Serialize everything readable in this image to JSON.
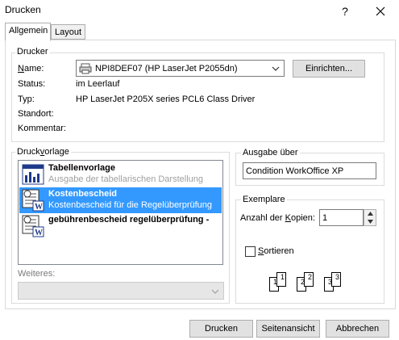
{
  "window": {
    "title": "Drucken",
    "help_label": "?",
    "close_label": "✕"
  },
  "tabs": [
    {
      "label": "Allgemein"
    },
    {
      "label": "Layout"
    }
  ],
  "printer": {
    "group_label": "Drucker",
    "name_label": "Name:",
    "name_value": "NPI8DEF07 (HP LaserJet P2055dn)",
    "setup_button": "Einrichten...",
    "status_label": "Status:",
    "status_value": "im Leerlauf",
    "type_label": "Typ:",
    "type_value": "HP LaserJet P205X series PCL6 Class Driver",
    "location_label": "Standort:",
    "location_value": "",
    "comment_label": "Kommentar:",
    "comment_value": ""
  },
  "template": {
    "group_label": "Druckvorlage",
    "items": [
      {
        "title": "Tabellenvorlage",
        "subtitle": "Ausgabe der tabellarischen Darstellung",
        "selected": false
      },
      {
        "title": "Kostenbescheid",
        "subtitle": "Kostenbescheid für die Regelüberprüfung",
        "selected": true
      },
      {
        "title": "gebührenbescheid regelüberprüfung -",
        "subtitle": "",
        "selected": false
      }
    ],
    "more_label": "Weiteres:",
    "more_value": ""
  },
  "output": {
    "group_label": "Ausgabe über",
    "value": "Condition WorkOffice XP"
  },
  "copies": {
    "group_label": "Exemplare",
    "count_label": "Anzahl der Kopien:",
    "count_value": "1",
    "collate_label": "Sortieren",
    "collate_checked": false,
    "page_labels": [
      "1",
      "1",
      "2",
      "2",
      "3",
      "3"
    ]
  },
  "buttons": {
    "print": "Drucken",
    "preview": "Seitenansicht",
    "cancel": "Abbrechen"
  }
}
